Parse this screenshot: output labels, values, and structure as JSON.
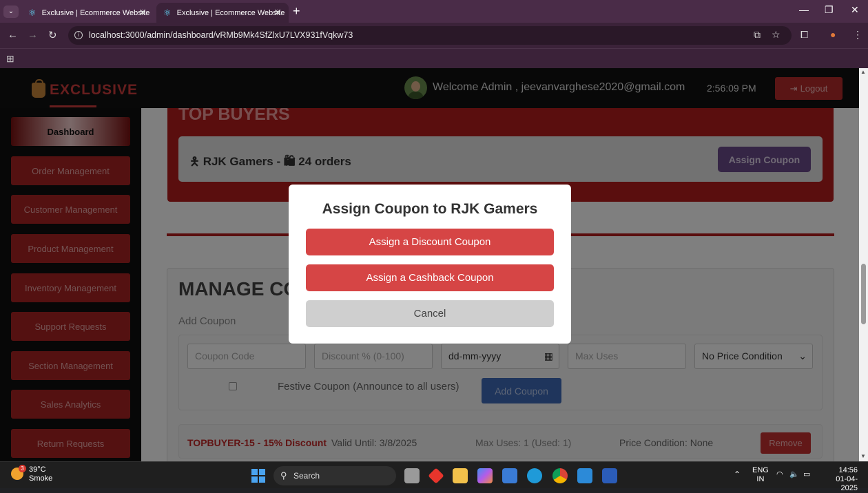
{
  "browser": {
    "tabs": [
      {
        "title": "Exclusive | Ecommerce Website"
      },
      {
        "title": "Exclusive | Ecommerce Website"
      }
    ],
    "url": "localhost:3000/admin/dashboard/vRMb9Mk4SfZlxU7LVX931fVqkw73"
  },
  "header": {
    "logo": "EXCLUSIVE",
    "welcome": "Welcome Admin , jeevanvarghese2020@gmail.com",
    "time": "2:56:09 PM",
    "logout": "Logout"
  },
  "sidebar": {
    "items": [
      {
        "label": "Dashboard"
      },
      {
        "label": "Order Management"
      },
      {
        "label": "Customer Management"
      },
      {
        "label": "Product Management"
      },
      {
        "label": "Inventory Management"
      },
      {
        "label": "Support Requests"
      },
      {
        "label": "Section Management"
      },
      {
        "label": "Sales Analytics"
      },
      {
        "label": "Return Requests"
      }
    ]
  },
  "top_buyers": {
    "title": "TOP BUYERS",
    "buyer_name": "RJK Gamers",
    "buyer_orders": "24 orders",
    "assign_button": "Assign Coupon"
  },
  "manage_coupons": {
    "title": "MANAGE CO",
    "add_coupon_label": "Add Coupon",
    "form": {
      "code_placeholder": "Coupon Code",
      "discount_placeholder": "Discount % (0-100)",
      "date_placeholder": "dd-mm-yyyy",
      "max_uses_placeholder": "Max Uses",
      "price_condition": "No Price Condition",
      "festive_label": "Festive Coupon (Announce to all users)",
      "add_button": "Add Coupon"
    },
    "coupons": [
      {
        "name": "TOPBUYER-15 - 15% Discount",
        "valid_until": "Valid Until: 3/8/2025",
        "max_uses": "Max Uses: 1 (Used: 1)",
        "price_condition": "Price Condition: None",
        "remove": "Remove"
      }
    ]
  },
  "modal": {
    "title": "Assign Coupon to RJK Gamers",
    "discount_button": "Assign a Discount Coupon",
    "cashback_button": "Assign a Cashback Coupon",
    "cancel_button": "Cancel"
  },
  "taskbar": {
    "weather_temp": "39°C",
    "weather_desc": "Smoke",
    "weather_badge": "3",
    "search": "Search",
    "lang": "ENG",
    "region": "IN",
    "time": "14:56",
    "date": "01-04-2025"
  },
  "colors": {
    "brand_red": "#b41c1c",
    "modal_button_red": "#d64545",
    "add_button_blue": "#3f6bb8"
  }
}
